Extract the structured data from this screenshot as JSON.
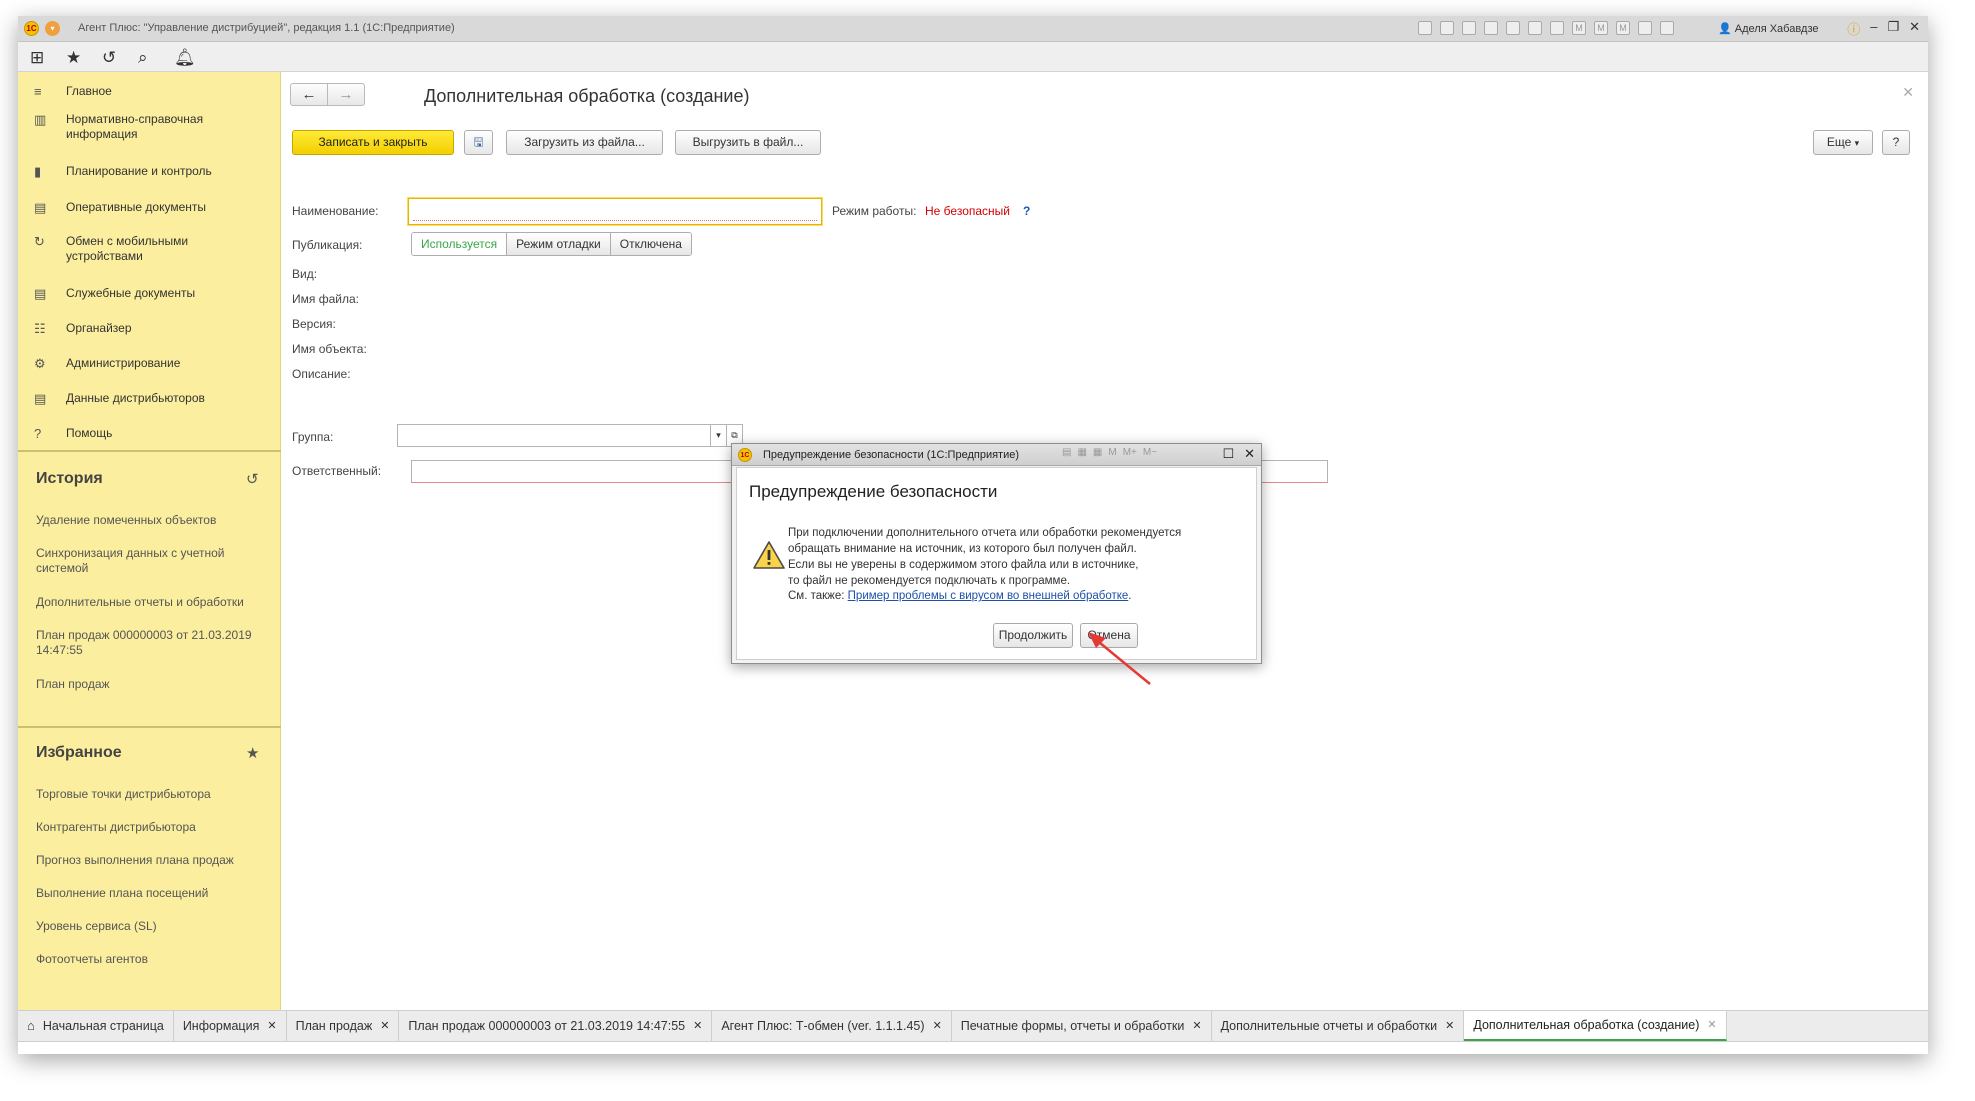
{
  "window": {
    "title": "Агент Плюс: \"Управление дистрибуцией\", редакция 1.1  (1С:Предприятие)",
    "user": "Аделя Хабавдзе",
    "logo_text": "1С"
  },
  "sidebar": {
    "items": [
      {
        "icon": "≡",
        "label": "Главное"
      },
      {
        "icon": "▥",
        "label": "Нормативно-справочная информация"
      },
      {
        "icon": "▮",
        "label": "Планирование и контроль"
      },
      {
        "icon": "▤",
        "label": "Оперативные документы"
      },
      {
        "icon": "↻",
        "label": "Обмен с мобильными устройствами"
      },
      {
        "icon": "▤",
        "label": "Служебные документы"
      },
      {
        "icon": "☷",
        "label": "Органайзер"
      },
      {
        "icon": "⚙",
        "label": "Администрирование"
      },
      {
        "icon": "▤",
        "label": "Данные дистрибьюторов"
      },
      {
        "icon": "?",
        "label": "Помощь"
      }
    ],
    "history": {
      "heading": "История",
      "links": [
        "Удаление помеченных объектов",
        "Синхронизация данных с учетной системой",
        "Дополнительные отчеты и обработки",
        "План продаж 000000003 от 21.03.2019 14:47:55",
        "План продаж"
      ]
    },
    "favorites": {
      "heading": "Избранное",
      "links": [
        "Торговые точки дистрибьютора",
        "Контрагенты дистрибьютора",
        "Прогноз выполнения плана продаж",
        "Выполнение плана посещений",
        "Уровень сервиса (SL)",
        "Фотоотчеты агентов"
      ]
    }
  },
  "form": {
    "title": "Дополнительная обработка (создание)",
    "buttons": {
      "save_close": "Записать и закрыть",
      "load_file": "Загрузить из файла...",
      "unload_file": "Выгрузить в файл...",
      "more": "Еще",
      "help": "?"
    },
    "fields": {
      "name_label": "Наименование:",
      "name_value": "",
      "mode_label": "Режим работы:",
      "mode_value": "Не безопасный",
      "mode_help": "?",
      "publication_label": "Публикация:",
      "publication_options": [
        "Используется",
        "Режим отладки",
        "Отключена"
      ],
      "kind_label": "Вид:",
      "filename_label": "Имя файла:",
      "version_label": "Версия:",
      "object_name_label": "Имя объекта:",
      "description_label": "Описание:",
      "group_label": "Группа:",
      "group_value": "",
      "responsible_label": "Ответственный:",
      "responsible_value": ""
    }
  },
  "dialog": {
    "window_title": "Предупреждение безопасности  (1С:Предприятие)",
    "heading": "Предупреждение безопасности",
    "text_lines": [
      "При подключении дополнительного отчета или обработки рекомендуется",
      "обращать внимание на источник, из которого был получен файл.",
      "Если вы не уверены в содержимом этого файла или в источнике,",
      "то файл не рекомендуется подключать к программе."
    ],
    "see_also_label": "См. также:",
    "see_also_link": "Пример проблемы с вирусом во внешней обработке",
    "see_also_suffix": ".",
    "continue_label": "Продолжить",
    "cancel_label": "Отмена"
  },
  "tabs": [
    {
      "label": "Начальная страница",
      "closable": false,
      "active": false
    },
    {
      "label": "Информация",
      "closable": true,
      "active": false
    },
    {
      "label": "План продаж",
      "closable": true,
      "active": false
    },
    {
      "label": "План продаж 000000003 от 21.03.2019 14:47:55",
      "closable": true,
      "active": false
    },
    {
      "label": "Агент Плюс: Т-обмен (ver. 1.1.1.45)",
      "closable": true,
      "active": false
    },
    {
      "label": "Печатные формы, отчеты и обработки",
      "closable": true,
      "active": false
    },
    {
      "label": "Дополнительные отчеты и обработки",
      "closable": true,
      "active": false
    },
    {
      "label": "Дополнительная обработка (создание)",
      "closable": true,
      "active": true
    }
  ],
  "colors": {
    "sidebar_bg": "#fbee9e",
    "primary_button": "#f3cf00",
    "danger_text": "#d20000",
    "link": "#1d50a8",
    "active_tab_underline": "#3aa548",
    "annotation_arrow": "#e53935"
  }
}
